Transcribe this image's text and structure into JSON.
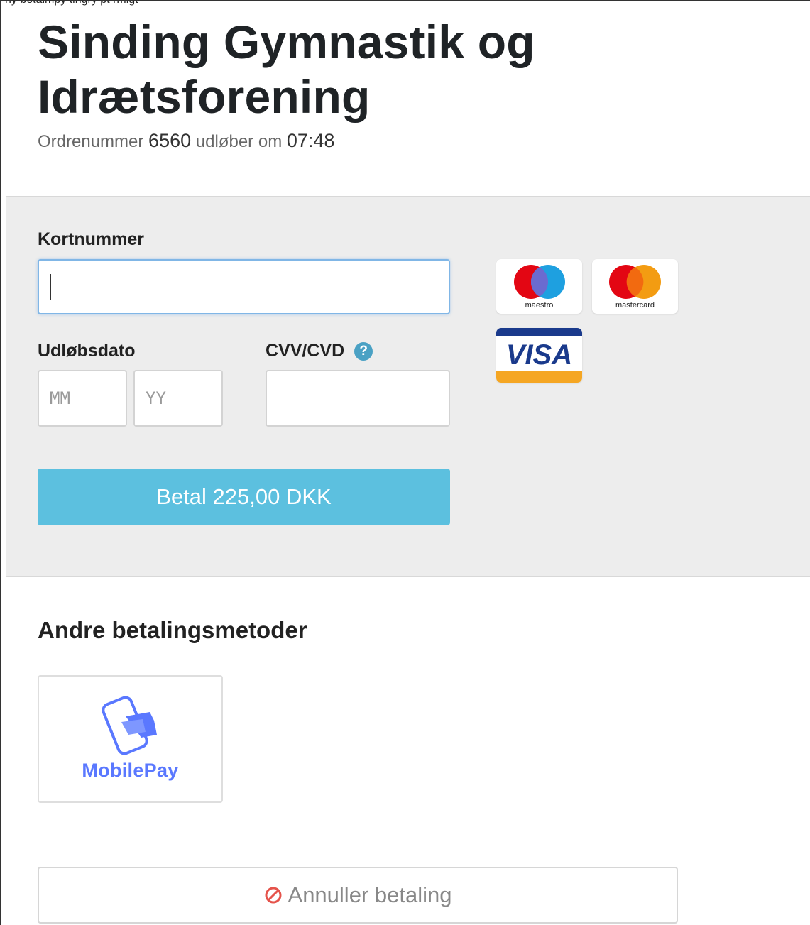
{
  "top_caption": "ny betalmpy tingry pt rmlgt",
  "header": {
    "title": "Sinding Gymnastik og Idrætsforening",
    "order_prefix": "Ordrenummer",
    "order_number": "6560",
    "expires_label": "udløber om",
    "expires_time": "07:48"
  },
  "card_form": {
    "card_number_label": "Kortnummer",
    "card_number_value": "",
    "expiry_label": "Udløbsdato",
    "expiry_month_placeholder": "MM",
    "expiry_year_placeholder": "YY",
    "cvv_label": "CVV/CVD",
    "cvv_help_icon": "?",
    "cvv_value": "",
    "pay_button_label": "Betal 225,00 DKK"
  },
  "card_logos": [
    {
      "name": "maestro",
      "label": "maestro"
    },
    {
      "name": "mastercard",
      "label": "mastercard"
    },
    {
      "name": "visa",
      "label": "VISA"
    }
  ],
  "other_methods": {
    "title": "Andre betalingsmetoder",
    "mobilepay_label": "MobilePay"
  },
  "cancel_button_label": "Annuller betaling",
  "colors": {
    "pay_button": "#5cc0df",
    "panel_background": "#ededed",
    "mobilepay_brand": "#5a78ff",
    "cancel_icon": "#e5534b",
    "help_icon": "#4aa1c4"
  }
}
